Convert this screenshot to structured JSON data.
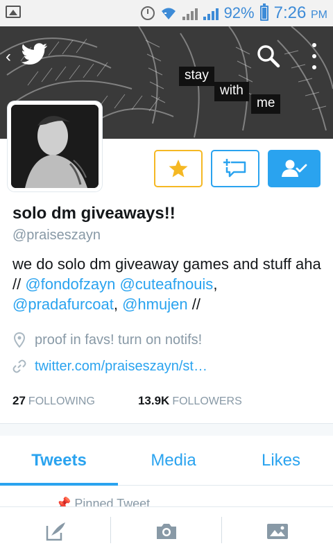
{
  "status_bar": {
    "battery": "92%",
    "time": "7:26",
    "ampm": "PM"
  },
  "header": {
    "banner_words": [
      "stay",
      "with",
      "me"
    ],
    "back": "‹"
  },
  "profile": {
    "name": "solo dm giveaways!!",
    "handle": "@praiseszayn",
    "bio_text_1": "we do solo dm giveaway games and stuff aha // ",
    "bio_mention_1": "@fondofzayn",
    "bio_space": " ",
    "bio_mention_2": "@cuteafnouis",
    "bio_comma": ", ",
    "bio_mention_3": "@pradafurcoat",
    "bio_comma_2": ", ",
    "bio_mention_4": "@hmujen",
    "bio_end": " //",
    "location": "proof in favs! turn on notifs!",
    "url": "twitter.com/praiseszayn/st…",
    "following_count": "27",
    "following_label": "FOLLOWING",
    "followers_count": "13.9K",
    "followers_label": "FOLLOWERS"
  },
  "tabs": [
    {
      "label": "Tweets"
    },
    {
      "label": "Media"
    },
    {
      "label": "Likes"
    }
  ],
  "pinned_label": "Pinned Tweet",
  "colors": {
    "accent": "#2aa3ef",
    "star": "#f5b823",
    "muted": "#8899a6"
  },
  "icons": [
    "twitter-bird-icon",
    "search-icon",
    "more-icon",
    "star-icon",
    "add-to-list-icon",
    "following-icon",
    "location-icon",
    "link-icon",
    "compose-icon",
    "camera-icon",
    "image-icon"
  ]
}
